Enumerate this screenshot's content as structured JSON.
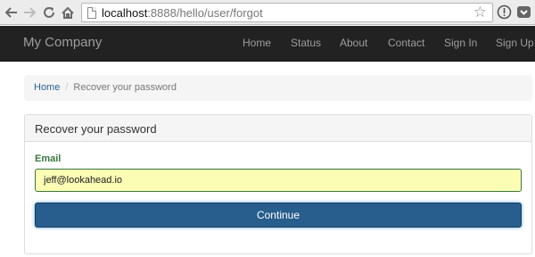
{
  "browser": {
    "url_host": "localhost",
    "url_path": ":8888/hello/user/forgot"
  },
  "navbar": {
    "brand": "My Company",
    "items": [
      "Home",
      "Status",
      "About",
      "Contact",
      "Sign In",
      "Sign Up"
    ]
  },
  "breadcrumb": {
    "home": "Home",
    "separator": "/",
    "current": "Recover your password"
  },
  "panel": {
    "title": "Recover your password",
    "email_label": "Email",
    "email_value": "jeff@lookahead.io",
    "submit_label": "Continue"
  },
  "colors": {
    "navbar_bg": "#222222",
    "link": "#2a6496",
    "label_success": "#3c763d",
    "input_autofill_bg": "#fbfdb4",
    "button_primary": "#285e8e"
  }
}
